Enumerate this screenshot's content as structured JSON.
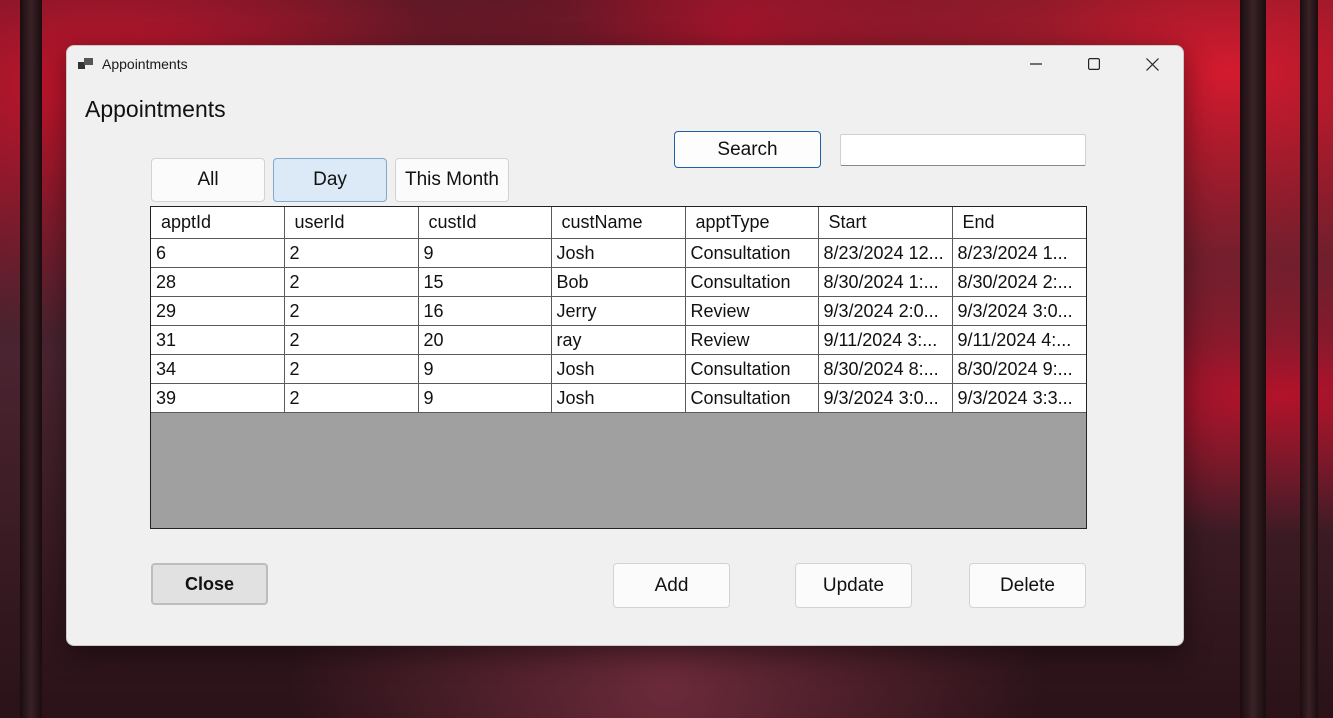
{
  "window": {
    "title": "Appointments",
    "controls": {
      "minimize": "minimize-icon",
      "maximize": "maximize-icon",
      "close": "close-icon"
    }
  },
  "heading": "Appointments",
  "filters": {
    "all": "All",
    "day": "Day",
    "month": "This Month",
    "selected": "Day"
  },
  "search": {
    "button": "Search",
    "value": ""
  },
  "table": {
    "columns": [
      "apptId",
      "userId",
      "custId",
      "custName",
      "apptType",
      "Start",
      "End"
    ],
    "rows": [
      [
        "6",
        "2",
        "9",
        "Josh",
        "Consultation",
        "8/23/2024 12...",
        "8/23/2024 1..."
      ],
      [
        "28",
        "2",
        "15",
        "Bob",
        "Consultation",
        "8/30/2024 1:...",
        "8/30/2024 2:..."
      ],
      [
        "29",
        "2",
        "16",
        "Jerry",
        "Review",
        "9/3/2024 2:0...",
        "9/3/2024 3:0..."
      ],
      [
        "31",
        "2",
        "20",
        "ray",
        "Review",
        "9/11/2024 3:...",
        "9/11/2024 4:..."
      ],
      [
        "34",
        "2",
        "9",
        "Josh",
        "Consultation",
        "8/30/2024 8:...",
        "8/30/2024 9:..."
      ],
      [
        "39",
        "2",
        "9",
        "Josh",
        "Consultation",
        "9/3/2024 3:0...",
        "9/3/2024 3:3..."
      ]
    ]
  },
  "actions": {
    "close": "Close",
    "add": "Add",
    "update": "Update",
    "delete": "Delete"
  },
  "colors": {
    "selected_tab": "#dbeaf6",
    "search_border": "#1f5fa8",
    "grid_empty": "#a0a0a0"
  }
}
